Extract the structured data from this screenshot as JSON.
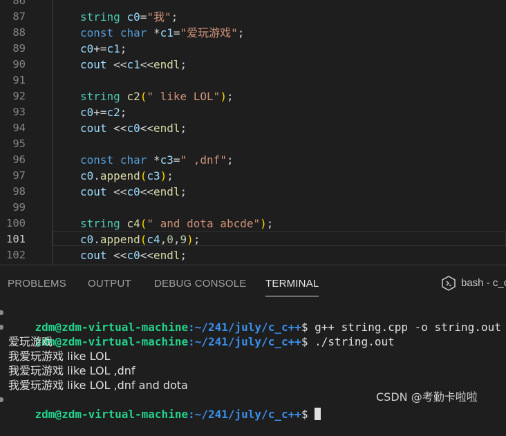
{
  "editor": {
    "lines": [
      {
        "n": "86",
        "tokens": []
      },
      {
        "n": "87",
        "tokens": [
          [
            "ty",
            "string"
          ],
          [
            "op",
            " "
          ],
          [
            "va",
            "c0"
          ],
          [
            "op",
            "="
          ],
          [
            "st",
            "\"我\""
          ],
          [
            "op",
            ";"
          ]
        ]
      },
      {
        "n": "88",
        "tokens": [
          [
            "kw",
            "const"
          ],
          [
            "op",
            " "
          ],
          [
            "kw",
            "char"
          ],
          [
            "op",
            " *"
          ],
          [
            "va",
            "c1"
          ],
          [
            "op",
            "="
          ],
          [
            "st",
            "\"爱玩游戏\""
          ],
          [
            "op",
            ";"
          ]
        ]
      },
      {
        "n": "89",
        "tokens": [
          [
            "va",
            "c0"
          ],
          [
            "op",
            "+="
          ],
          [
            "va",
            "c1"
          ],
          [
            "op",
            ";"
          ]
        ]
      },
      {
        "n": "90",
        "tokens": [
          [
            "va",
            "cout"
          ],
          [
            "op",
            " <<"
          ],
          [
            "va",
            "c1"
          ],
          [
            "op",
            "<<"
          ],
          [
            "fn",
            "endl"
          ],
          [
            "op",
            ";"
          ]
        ]
      },
      {
        "n": "91",
        "tokens": []
      },
      {
        "n": "92",
        "tokens": [
          [
            "ty",
            "string"
          ],
          [
            "op",
            " "
          ],
          [
            "fn",
            "c2"
          ],
          [
            "pa",
            "("
          ],
          [
            "st",
            "\" like LOL\""
          ],
          [
            "pa",
            ")"
          ],
          [
            "op",
            ";"
          ]
        ]
      },
      {
        "n": "93",
        "tokens": [
          [
            "va",
            "c0"
          ],
          [
            "op",
            "+="
          ],
          [
            "va",
            "c2"
          ],
          [
            "op",
            ";"
          ]
        ]
      },
      {
        "n": "94",
        "tokens": [
          [
            "va",
            "cout"
          ],
          [
            "op",
            " <<"
          ],
          [
            "va",
            "c0"
          ],
          [
            "op",
            "<<"
          ],
          [
            "fn",
            "endl"
          ],
          [
            "op",
            ";"
          ]
        ]
      },
      {
        "n": "95",
        "tokens": []
      },
      {
        "n": "96",
        "tokens": [
          [
            "kw",
            "const"
          ],
          [
            "op",
            " "
          ],
          [
            "kw",
            "char"
          ],
          [
            "op",
            " *"
          ],
          [
            "va",
            "c3"
          ],
          [
            "op",
            "="
          ],
          [
            "st",
            "\" ,dnf\""
          ],
          [
            "op",
            ";"
          ]
        ]
      },
      {
        "n": "97",
        "tokens": [
          [
            "va",
            "c0"
          ],
          [
            "op",
            "."
          ],
          [
            "fn",
            "append"
          ],
          [
            "pa",
            "("
          ],
          [
            "va",
            "c3"
          ],
          [
            "pa",
            ")"
          ],
          [
            "op",
            ";"
          ]
        ]
      },
      {
        "n": "98",
        "tokens": [
          [
            "va",
            "cout"
          ],
          [
            "op",
            " <<"
          ],
          [
            "va",
            "c0"
          ],
          [
            "op",
            "<<"
          ],
          [
            "fn",
            "endl"
          ],
          [
            "op",
            ";"
          ]
        ]
      },
      {
        "n": "99",
        "tokens": []
      },
      {
        "n": "100",
        "tokens": [
          [
            "ty",
            "string"
          ],
          [
            "op",
            " "
          ],
          [
            "fn",
            "c4"
          ],
          [
            "pa",
            "("
          ],
          [
            "st",
            "\" and dota abcde\""
          ],
          [
            "pa",
            ")"
          ],
          [
            "op",
            ";"
          ]
        ]
      },
      {
        "n": "101",
        "tokens": [
          [
            "va",
            "c0"
          ],
          [
            "op",
            "."
          ],
          [
            "fn",
            "append"
          ],
          [
            "pa",
            "("
          ],
          [
            "va",
            "c4"
          ],
          [
            "op",
            ","
          ],
          [
            "nu",
            "0"
          ],
          [
            "op",
            ","
          ],
          [
            "nu",
            "9"
          ],
          [
            "pa",
            ")"
          ],
          [
            "op",
            ";"
          ]
        ],
        "current": true
      },
      {
        "n": "102",
        "tokens": [
          [
            "va",
            "cout"
          ],
          [
            "op",
            " <<"
          ],
          [
            "va",
            "c0"
          ],
          [
            "op",
            "<<"
          ],
          [
            "fn",
            "endl"
          ],
          [
            "op",
            ";"
          ]
        ]
      }
    ]
  },
  "panel": {
    "tabs": [
      "PROBLEMS",
      "OUTPUT",
      "DEBUG CONSOLE",
      "TERMINAL"
    ],
    "active_tab": "TERMINAL",
    "terminal_name": "bash - c_c",
    "terminal_icon": "terminal-bash-icon"
  },
  "terminal": {
    "user_host": "zdm@zdm-virtual-machine",
    "path": ":~/241/july/c_c++",
    "prompt_suffix": "$ ",
    "commands": [
      "g++ string.cpp -o string.out",
      "./string.out"
    ],
    "output": [
      "爱玩游戏",
      "我爱玩游戏 like LOL",
      "我爱玩游戏 like LOL ,dnf",
      "我爱玩游戏 like LOL ,dnf and dota"
    ]
  },
  "watermark": "CSDN @考勤卡啦啦"
}
